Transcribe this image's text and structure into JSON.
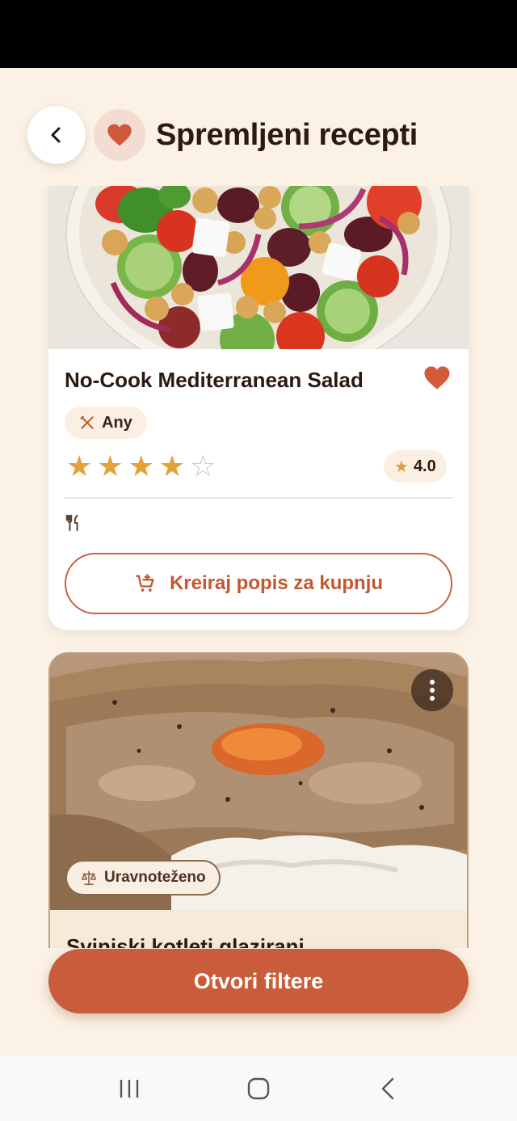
{
  "header": {
    "title": "Spremljeni recepti"
  },
  "icons": {
    "back": "chevron-left-icon",
    "heart": "heart-icon",
    "favorite": "heart-icon",
    "chef": "utensils-crossed-icon",
    "utensils": "fork-knife-icon",
    "cart": "add-to-cart-icon",
    "more": "more-vertical-icon",
    "balance": "scales-icon"
  },
  "recipes": [
    {
      "title": "No-Cook Mediterranean Salad",
      "tag": "Any",
      "rating": 4,
      "rating_max": 5,
      "rating_label": "4.0",
      "shopping_button": "Kreiraj popis za kupnju",
      "favorite": true
    },
    {
      "title": "Svinjski kotleti glazirani",
      "tag": "Uravnoteženo"
    }
  ],
  "filters_button": "Otvori filtere",
  "colors": {
    "accent": "#c85c3b",
    "background": "#fbf1e4",
    "star": "#e3a23a",
    "heart": "#d55a3a"
  }
}
